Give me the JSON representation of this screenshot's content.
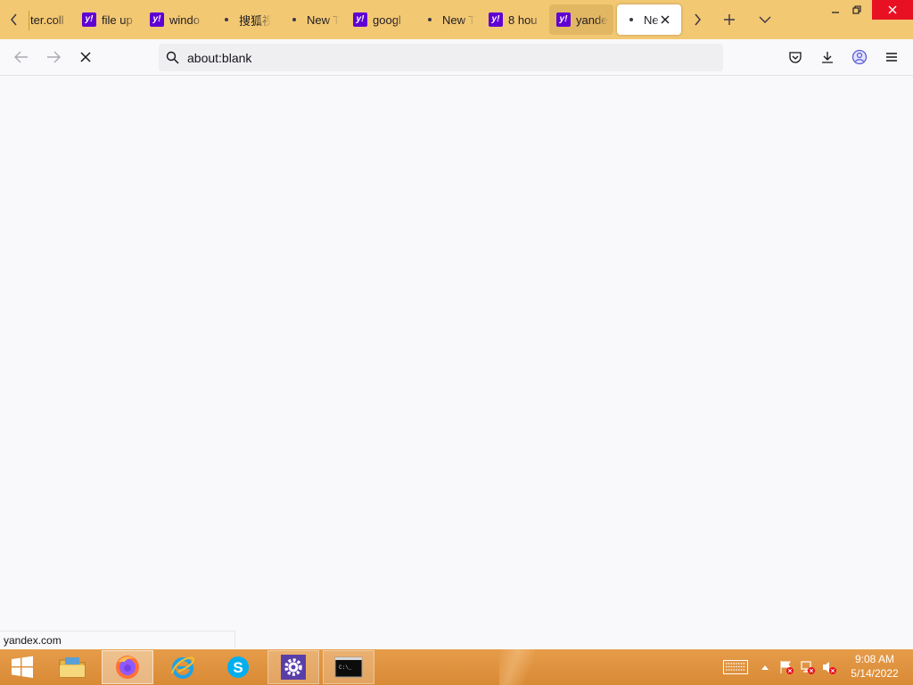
{
  "tabs": [
    {
      "label": "ter.coll",
      "favicon": "none"
    },
    {
      "label": "file up",
      "favicon": "yahoo-icon"
    },
    {
      "label": "windo",
      "favicon": "yahoo-icon"
    },
    {
      "label": "搜狐视",
      "favicon": "dot-icon"
    },
    {
      "label": "New T",
      "favicon": "dot-icon"
    },
    {
      "label": "googl",
      "favicon": "yahoo-icon"
    },
    {
      "label": "New T",
      "favicon": "dot-icon"
    },
    {
      "label": "8 hou",
      "favicon": "yahoo-icon"
    },
    {
      "label": "yande",
      "favicon": "yahoo-icon"
    },
    {
      "label": "Ne",
      "favicon": "dot-icon"
    }
  ],
  "address_bar": {
    "value": "about:blank",
    "placeholder": ""
  },
  "status_text": "yandex.com",
  "clock": {
    "time": "9:08 AM",
    "date": "5/14/2022"
  },
  "theme": {
    "tabstrip": "#f3c873",
    "taskbar": "#e69c4a",
    "yahoo_purple": "#6001d2",
    "close_red": "#e81123"
  }
}
